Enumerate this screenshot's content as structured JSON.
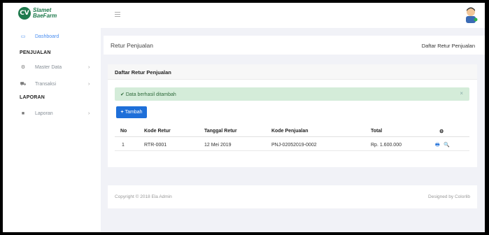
{
  "brand": {
    "badge": "CV",
    "line1": "Slamet",
    "line2": "BaeFarm"
  },
  "sidebar": {
    "dashboard": {
      "label": "Dashboard",
      "icon": "laptop-icon"
    },
    "heading_sales": "PENJUALAN",
    "master_data": {
      "label": "Master Data",
      "icon": "cogs-icon",
      "chevron": "›"
    },
    "transaksi": {
      "label": "Transaksi",
      "icon": "cart-icon",
      "chevron": "›"
    },
    "heading_report": "LAPORAN",
    "laporan": {
      "label": "Laporan",
      "icon": "book-icon",
      "chevron": "›"
    }
  },
  "page": {
    "title": "Retur Penjualan",
    "breadcrumb": "Daftar Retur Penjualan"
  },
  "card": {
    "title": "Daftar Retur Penjualan",
    "alert_icon": "✔",
    "alert": "Data berhasil ditambah",
    "alert_close": "×",
    "add_button": "Tambah",
    "add_icon": "+"
  },
  "table": {
    "headers": [
      "No",
      "Kode Retur",
      "Tanggal Retur",
      "Kode Penjualan",
      "Total",
      "⚙"
    ],
    "rows": [
      {
        "no": "1",
        "kode_retur": "RTR-0001",
        "tanggal": "12 Mei 2019",
        "kode_penjualan": "PNJ-02052019-0002",
        "total": "Rp. 1.600.000"
      }
    ],
    "actions": {
      "print": "🖶",
      "view": "🔍"
    }
  },
  "footer": {
    "left": "Copyright © 2018 Ela Admin",
    "right": "Designed by Colorlib"
  },
  "colors": {
    "accent": "#1e6fd9",
    "brand": "#1f7a4d",
    "alert_bg": "#d4ecd9"
  }
}
